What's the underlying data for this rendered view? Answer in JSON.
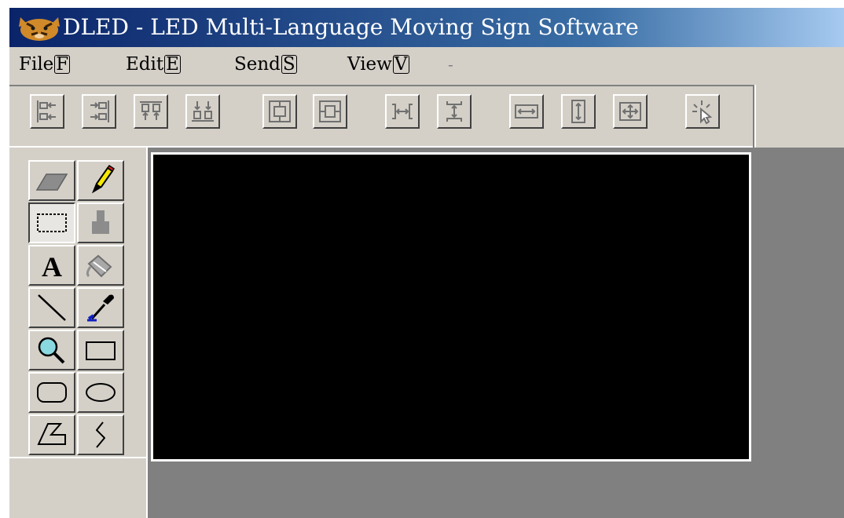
{
  "window": {
    "title": "DLED - LED Multi-Language Moving Sign Software"
  },
  "menubar": {
    "items": [
      {
        "label": "File",
        "accel": "F"
      },
      {
        "label": "Edit",
        "accel": "E"
      },
      {
        "label": "Send",
        "accel": "S"
      },
      {
        "label": "View",
        "accel": "V"
      }
    ],
    "separator": "-"
  },
  "toolbar": {
    "buttons": [
      "align-left-icon",
      "align-right-icon",
      "align-top-icon",
      "align-bottom-icon",
      "center-vertical-icon",
      "center-horizontal-icon",
      "space-horizontal-icon",
      "space-vertical-icon",
      "same-width-icon",
      "same-height-icon",
      "same-size-icon",
      "select-pointer-icon"
    ]
  },
  "tools": [
    "eraser-icon",
    "pencil-icon",
    "rect-select-icon",
    "stamp-icon",
    "text-icon",
    "fill-icon",
    "line-icon",
    "color-picker-icon",
    "magnifier-icon",
    "rectangle-icon",
    "rounded-rect-icon",
    "ellipse-icon",
    "polygon-icon",
    "curve-icon"
  ],
  "colors": {
    "title_start": "#0a246a",
    "title_end": "#a6caf0",
    "face": "#d4d0c8",
    "workspace": "#808080",
    "canvas": "#000000"
  }
}
